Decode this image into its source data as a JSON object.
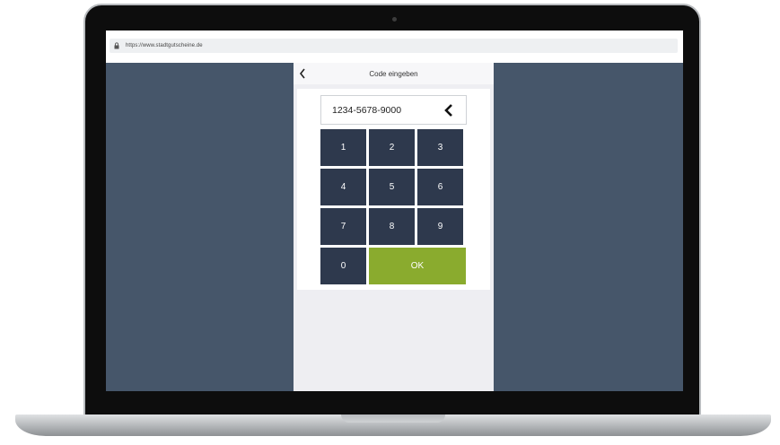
{
  "browser": {
    "url": "https://www.stadtgutscheine.de"
  },
  "app": {
    "title": "Code eingeben",
    "code_value": "1234-5678-9000"
  },
  "keypad": {
    "keys": [
      "1",
      "2",
      "3",
      "4",
      "5",
      "6",
      "7",
      "8",
      "9",
      "0"
    ],
    "ok_label": "OK"
  },
  "colors": {
    "screen_background": "#46566a",
    "key_background": "#2e394d",
    "ok_background": "#8aab2e",
    "panel_background": "#eeeef2"
  }
}
